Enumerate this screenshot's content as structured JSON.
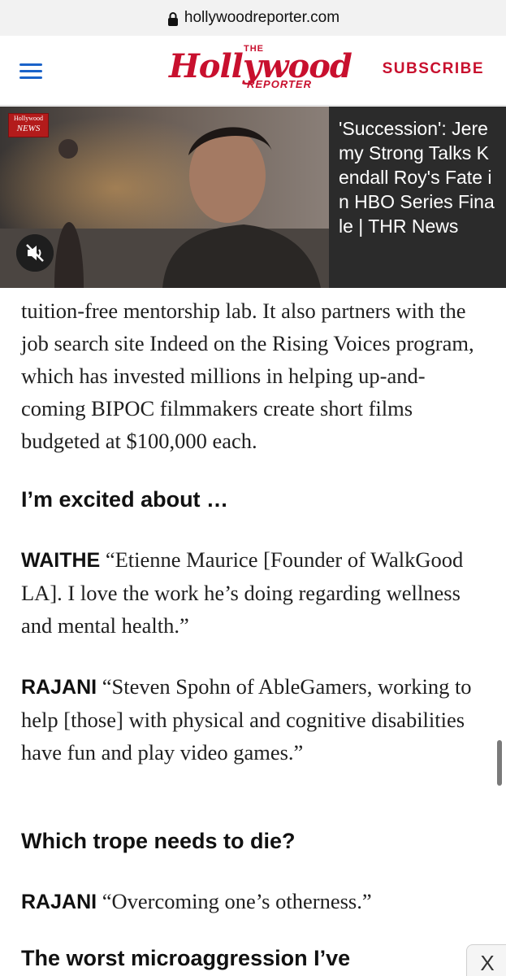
{
  "browser": {
    "url": "hollywoodreporter.com"
  },
  "header": {
    "logo_the": "THE",
    "logo_main": "Hollywood",
    "logo_reporter": "REPORTER",
    "subscribe_label": "SUBSCRIBE"
  },
  "video": {
    "badge_top": "Hollywood",
    "badge_news": "NEWS",
    "title": "'Succession': Jeremy Strong Talks Kendall Roy's Fate in HBO Series Finale | THR News"
  },
  "article": {
    "para1": "tuition-free mentorship lab. It also partners with the job search site Indeed on the Rising Voices program, which has invested millions in helping up-and-coming BIPOC filmmakers create short films budgeted at $100,000 each.",
    "heading1": "I’m excited about …",
    "para2_speaker": "WAITHE",
    "para2_text": " “Etienne Maurice [Founder of WalkGood LA]. I love the work he’s doing regarding wellness and mental health.”",
    "para3_speaker": "RAJANI",
    "para3_text": " “Steven Spohn of AbleGamers, working to help [those] with physical and cognitive disabilities have fun and play video games.”",
    "heading2": "Which trope needs to die?",
    "para4_speaker": "RAJANI",
    "para4_text": " “Overcoming one’s otherness.”",
    "heading3": "The worst microaggression I’ve"
  },
  "ad": {
    "close_label": "X"
  },
  "icons": [
    "lock-icon",
    "hamburger-menu-icon",
    "mute-icon"
  ],
  "colors": {
    "brand_red": "#c8102e",
    "menu_blue": "#1b63c9",
    "video_panel": "#2b2b2b"
  }
}
